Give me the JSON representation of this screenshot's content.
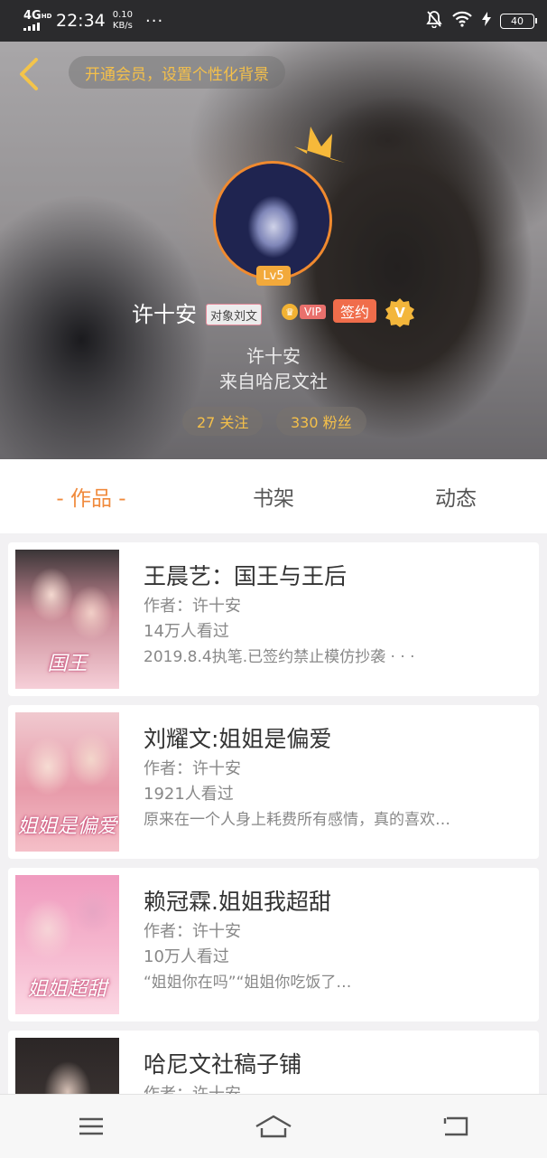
{
  "status_bar": {
    "network": "4G",
    "network_sup": "HD",
    "time": "22:34",
    "speed_value": "0.10",
    "speed_unit": "KB/s",
    "more": "···",
    "battery": "40"
  },
  "header": {
    "vip_prompt": "开通会员，设置个性化背景",
    "level": "Lv5",
    "user_name": "许十安",
    "partner_tag": "对象刘文",
    "vip_tag": "VIP",
    "signed_tag": "签约",
    "verified_tag": "V",
    "pen_name": "许十安",
    "org_line": "来自哈尼文社",
    "following": "27 关注",
    "followers": "330 粉丝"
  },
  "tabs": [
    {
      "label": "- 作品 -",
      "active": true
    },
    {
      "label": "书架",
      "active": false
    },
    {
      "label": "动态",
      "active": false
    }
  ],
  "books": [
    {
      "title": "王晨艺：国王与王后",
      "author": "作者：许十安",
      "views": "14万人看过",
      "description": "2019.8.4执笔.已签约禁止模仿抄袭 · · ·",
      "cover_text": "国王"
    },
    {
      "title": "刘耀文:姐姐是偏爱",
      "author": "作者：许十安",
      "views": "1921人看过",
      "description": "原来在一个人身上耗费所有感情，真的喜欢…",
      "cover_text": "姐姐是偏爱"
    },
    {
      "title": "赖冠霖.姐姐我超甜",
      "author": "作者：许十安",
      "views": "10万人看过",
      "description": "“姐姐你在吗”“姐姐你吃饭了…",
      "cover_text": "姐姐超甜"
    },
    {
      "title": "哈尼文社稿子铺",
      "author": "作者：许十安",
      "views": "",
      "description": "",
      "cover_text": ""
    }
  ],
  "colors": {
    "accent_orange": "#f08a3c",
    "gold_text": "#f5c04a",
    "signed_red": "#f06d4b"
  },
  "icons": {
    "back": "chevron-left-icon",
    "crown": "crown-icon",
    "menu": "menu-icon",
    "home": "home-icon",
    "return": "return-icon"
  }
}
